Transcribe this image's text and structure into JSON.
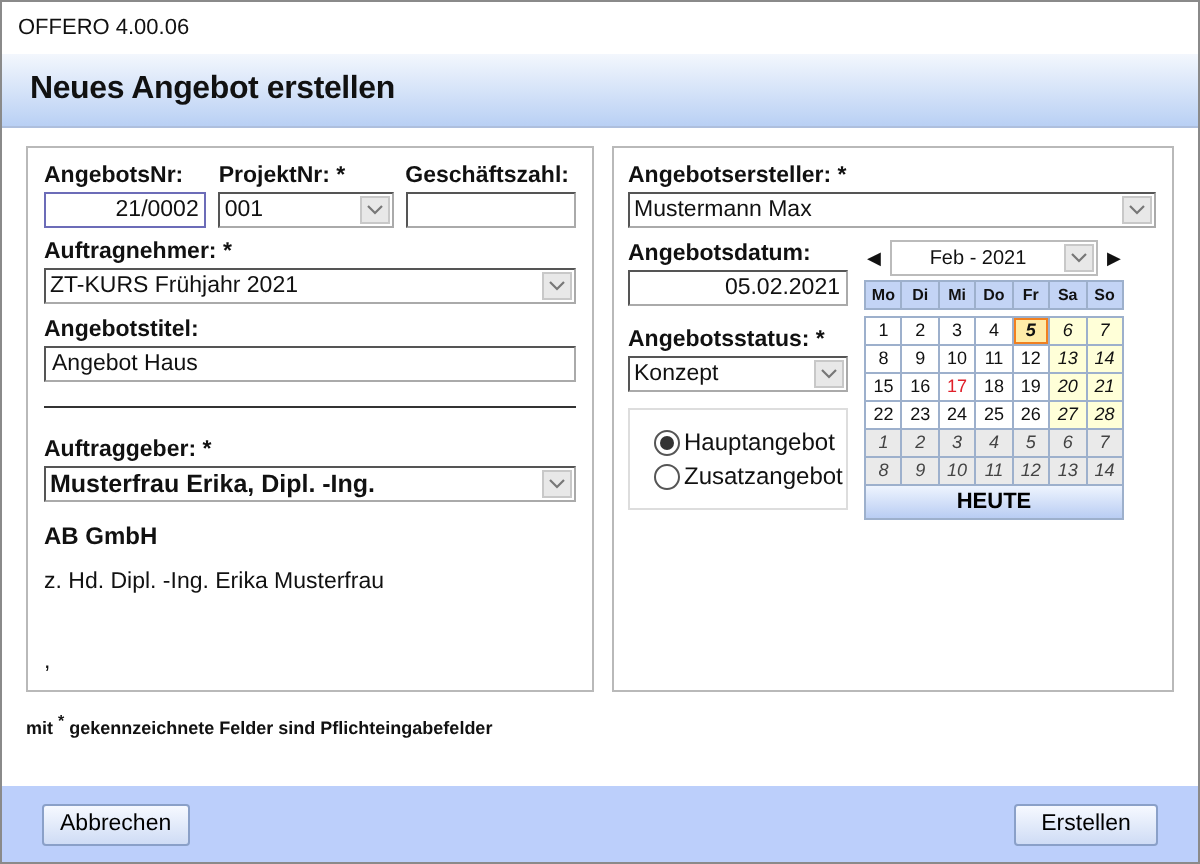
{
  "window": {
    "title": "OFFERO 4.00.06"
  },
  "header": {
    "title": "Neues Angebot erstellen"
  },
  "left_panel": {
    "angebotsnr": {
      "label": "AngebotsNr:",
      "value": "21/0002",
      "focused": true
    },
    "projektnr": {
      "label": "ProjektNr: *",
      "value": "001"
    },
    "geschaeftszahl": {
      "label": "Geschäftszahl:"
    },
    "auftragnehmer": {
      "label": "Auftragnehmer: *",
      "value": "ZT-KURS Frühjahr 2021"
    },
    "angebotstitel": {
      "label": "Angebotstitel:",
      "value": "Angebot Haus"
    },
    "auftraggeber": {
      "label": "Auftraggeber: *",
      "value": "Musterfrau Erika, Dipl. -Ing."
    },
    "company": "AB GmbH",
    "attention": "z. Hd. Dipl. -Ing. Erika Musterfrau",
    "address_line": ","
  },
  "right_panel": {
    "angebotsersteller": {
      "label": "Angebotsersteller: *",
      "value": "Mustermann Max"
    },
    "angebotsdatum": {
      "label": "Angebotsdatum:",
      "value": "05.02.2021"
    },
    "angebotsstatus": {
      "label": "Angebotsstatus: *",
      "value": "Konzept"
    },
    "offer_type": [
      {
        "label": "Hauptangebot",
        "selected": true
      },
      {
        "label": "Zusatzangebot",
        "selected": false
      }
    ],
    "calendar": {
      "prev": "◀",
      "month": "Feb - 2021",
      "next": "▶",
      "weekdays": [
        "Mo",
        "Di",
        "Mi",
        "Do",
        "Fr",
        "Sa",
        "So"
      ],
      "weeks": [
        [
          {
            "day": "1",
            "kind": "workday",
            "selected": false
          },
          {
            "day": "2",
            "kind": "workday",
            "selected": false
          },
          {
            "day": "3",
            "kind": "workday",
            "selected": false
          },
          {
            "day": "4",
            "kind": "workday",
            "selected": false
          },
          {
            "day": "5",
            "kind": "workday",
            "selected": true
          },
          {
            "day": "6",
            "kind": "weekend",
            "selected": false
          },
          {
            "day": "7",
            "kind": "weekend",
            "selected": false
          }
        ],
        [
          {
            "day": "8",
            "kind": "workday",
            "selected": false
          },
          {
            "day": "9",
            "kind": "workday",
            "selected": false
          },
          {
            "day": "10",
            "kind": "workday",
            "selected": false
          },
          {
            "day": "11",
            "kind": "workday",
            "selected": false
          },
          {
            "day": "12",
            "kind": "workday",
            "selected": false
          },
          {
            "day": "13",
            "kind": "weekend",
            "selected": false
          },
          {
            "day": "14",
            "kind": "weekend",
            "selected": false
          }
        ],
        [
          {
            "day": "15",
            "kind": "workday",
            "selected": false
          },
          {
            "day": "16",
            "kind": "workday",
            "selected": false
          },
          {
            "day": "17",
            "kind": "holiday",
            "selected": false
          },
          {
            "day": "18",
            "kind": "workday",
            "selected": false
          },
          {
            "day": "19",
            "kind": "workday",
            "selected": false
          },
          {
            "day": "20",
            "kind": "weekend",
            "selected": false
          },
          {
            "day": "21",
            "kind": "weekend",
            "selected": false
          }
        ],
        [
          {
            "day": "22",
            "kind": "workday",
            "selected": false
          },
          {
            "day": "23",
            "kind": "workday",
            "selected": false
          },
          {
            "day": "24",
            "kind": "workday",
            "selected": false
          },
          {
            "day": "25",
            "kind": "workday",
            "selected": false
          },
          {
            "day": "26",
            "kind": "workday",
            "selected": false
          },
          {
            "day": "27",
            "kind": "weekend",
            "selected": false
          },
          {
            "day": "28",
            "kind": "weekend",
            "selected": false
          }
        ],
        [
          {
            "day": "1",
            "kind": "other",
            "selected": false
          },
          {
            "day": "2",
            "kind": "other",
            "selected": false
          },
          {
            "day": "3",
            "kind": "other",
            "selected": false
          },
          {
            "day": "4",
            "kind": "other",
            "selected": false
          },
          {
            "day": "5",
            "kind": "other",
            "selected": false
          },
          {
            "day": "6",
            "kind": "other",
            "selected": false
          },
          {
            "day": "7",
            "kind": "other",
            "selected": false
          }
        ],
        [
          {
            "day": "8",
            "kind": "other",
            "selected": false
          },
          {
            "day": "9",
            "kind": "other",
            "selected": false
          },
          {
            "day": "10",
            "kind": "other",
            "selected": false
          },
          {
            "day": "11",
            "kind": "other",
            "selected": false
          },
          {
            "day": "12",
            "kind": "other",
            "selected": false
          },
          {
            "day": "13",
            "kind": "other",
            "selected": false
          },
          {
            "day": "14",
            "kind": "other",
            "selected": false
          }
        ]
      ],
      "today_button": "HEUTE"
    }
  },
  "footnote": "mit $^{*}$ gekennzeichnete Felder sind Pflichteingabefelder",
  "buttons": {
    "cancel": "Abbrechen",
    "create": "Erstellen"
  }
}
